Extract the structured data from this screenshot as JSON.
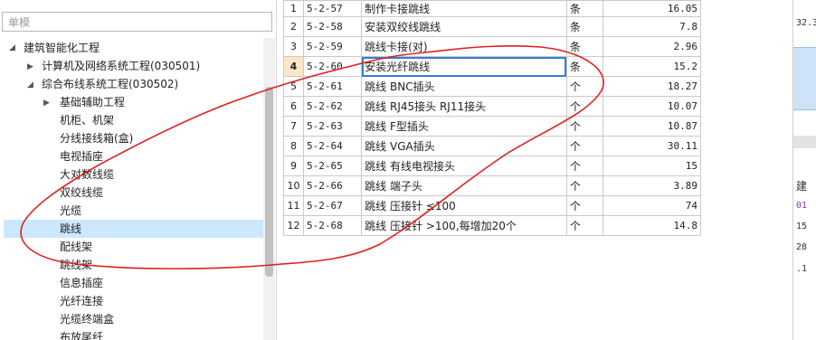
{
  "search": {
    "placeholder": "单模"
  },
  "tree": {
    "root": "建筑智能化工程",
    "child1": "计算机及网络系统工程(030501)",
    "child2": "综合布线系统工程(030502)",
    "items": [
      "基础辅助工程",
      "机柜、机架",
      "分线接线箱(盒)",
      "电视插座",
      "大对数线缆",
      "双绞线缆",
      "光缆",
      "跳线",
      "配线架",
      "跳线架",
      "信息插座",
      "光纤连接",
      "光缆终端盒",
      "布放尾纤"
    ],
    "selected": "跳线"
  },
  "table": {
    "rows": [
      {
        "idx": "1",
        "code": "5-2-57",
        "name": "制作卡接跳线",
        "unit": "条",
        "qty": "16.05"
      },
      {
        "idx": "2",
        "code": "5-2-58",
        "name": "安装双绞线跳线",
        "unit": "条",
        "qty": "7.8"
      },
      {
        "idx": "3",
        "code": "5-2-59",
        "name": "跳线卡接(对)",
        "unit": "条",
        "qty": "2.96"
      },
      {
        "idx": "4",
        "code": "5-2-60",
        "name": "安装光纤跳线",
        "unit": "条",
        "qty": "15.2"
      },
      {
        "idx": "5",
        "code": "5-2-61",
        "name": "跳线 BNC插头",
        "unit": "个",
        "qty": "18.27"
      },
      {
        "idx": "6",
        "code": "5-2-62",
        "name": "跳线 RJ45接头 RJ11接头",
        "unit": "个",
        "qty": "10.07"
      },
      {
        "idx": "7",
        "code": "5-2-63",
        "name": "跳线 F型插头",
        "unit": "个",
        "qty": "10.87"
      },
      {
        "idx": "8",
        "code": "5-2-64",
        "name": "跳线 VGA插头",
        "unit": "个",
        "qty": "30.11"
      },
      {
        "idx": "9",
        "code": "5-2-65",
        "name": "跳线 有线电视接头",
        "unit": "个",
        "qty": "15"
      },
      {
        "idx": "10",
        "code": "5-2-66",
        "name": "跳线 端子头",
        "unit": "个",
        "qty": "3.89"
      },
      {
        "idx": "11",
        "code": "5-2-67",
        "name": "跳线 压接针 ≤100",
        "unit": "个",
        "qty": "74"
      },
      {
        "idx": "12",
        "code": "5-2-68",
        "name": "跳线 压接针 >100,每增加20个",
        "unit": "个",
        "qty": "14.8"
      }
    ],
    "current_row": "4"
  },
  "right_panel": {
    "top_value": "32.3",
    "header_char": "建",
    "values": [
      "01",
      "15",
      "28",
      ".1"
    ]
  },
  "colors": {
    "selection": "#cce8ff",
    "annotation": "#e02020",
    "current_row_index": "#fbe7c6"
  }
}
